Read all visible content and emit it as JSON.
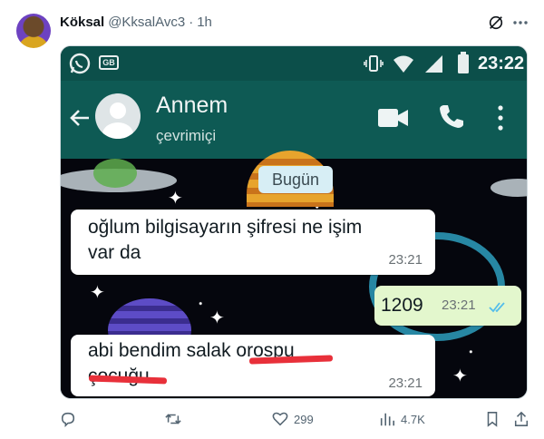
{
  "tweet": {
    "display_name": "Köksal",
    "handle": "@KksalAvc3",
    "separator": "·",
    "time": "1h",
    "avatar_icon": "profile-avatar",
    "header_icons": [
      "grok-icon",
      "more-icon"
    ]
  },
  "phone": {
    "status_bar": {
      "clock": "23:22",
      "badge": "GB",
      "icons": [
        "whatsapp-icon",
        "gb-icon",
        "vibrate-icon",
        "wifi-icon",
        "signal-icon",
        "battery-icon"
      ]
    },
    "app_bar": {
      "contact_name": "Annem",
      "contact_status": "çevrimiçi",
      "icons": [
        "back-arrow-icon",
        "contact-avatar",
        "video-call-icon",
        "phone-call-icon",
        "overflow-menu-icon"
      ]
    },
    "chat": {
      "date_chip": "Bugün",
      "messages": [
        {
          "direction": "incoming",
          "text": "oğlum bilgisayarın şifresi ne işim var da",
          "time": "23:21"
        },
        {
          "direction": "outgoing",
          "text": "1209",
          "time": "23:21",
          "status_icon": "double-check-icon"
        },
        {
          "direction": "incoming",
          "text": "abi bendim salak orospu çocuğu",
          "time": "23:21",
          "censored_words": "orospu çocuğu"
        }
      ]
    }
  },
  "actions": {
    "reply": {
      "icon": "reply-icon",
      "count": ""
    },
    "retweet": {
      "icon": "retweet-icon",
      "count": ""
    },
    "like": {
      "icon": "heart-icon",
      "count": "299"
    },
    "views": {
      "icon": "views-icon",
      "count": "4.7K"
    },
    "bookmark": {
      "icon": "bookmark-icon"
    },
    "share": {
      "icon": "share-icon"
    }
  },
  "colors": {
    "whatsapp_header": "#0e5a54",
    "censor": "#e8303a",
    "outgoing_bubble": "#e3f7cd",
    "muted_text": "#536471"
  }
}
